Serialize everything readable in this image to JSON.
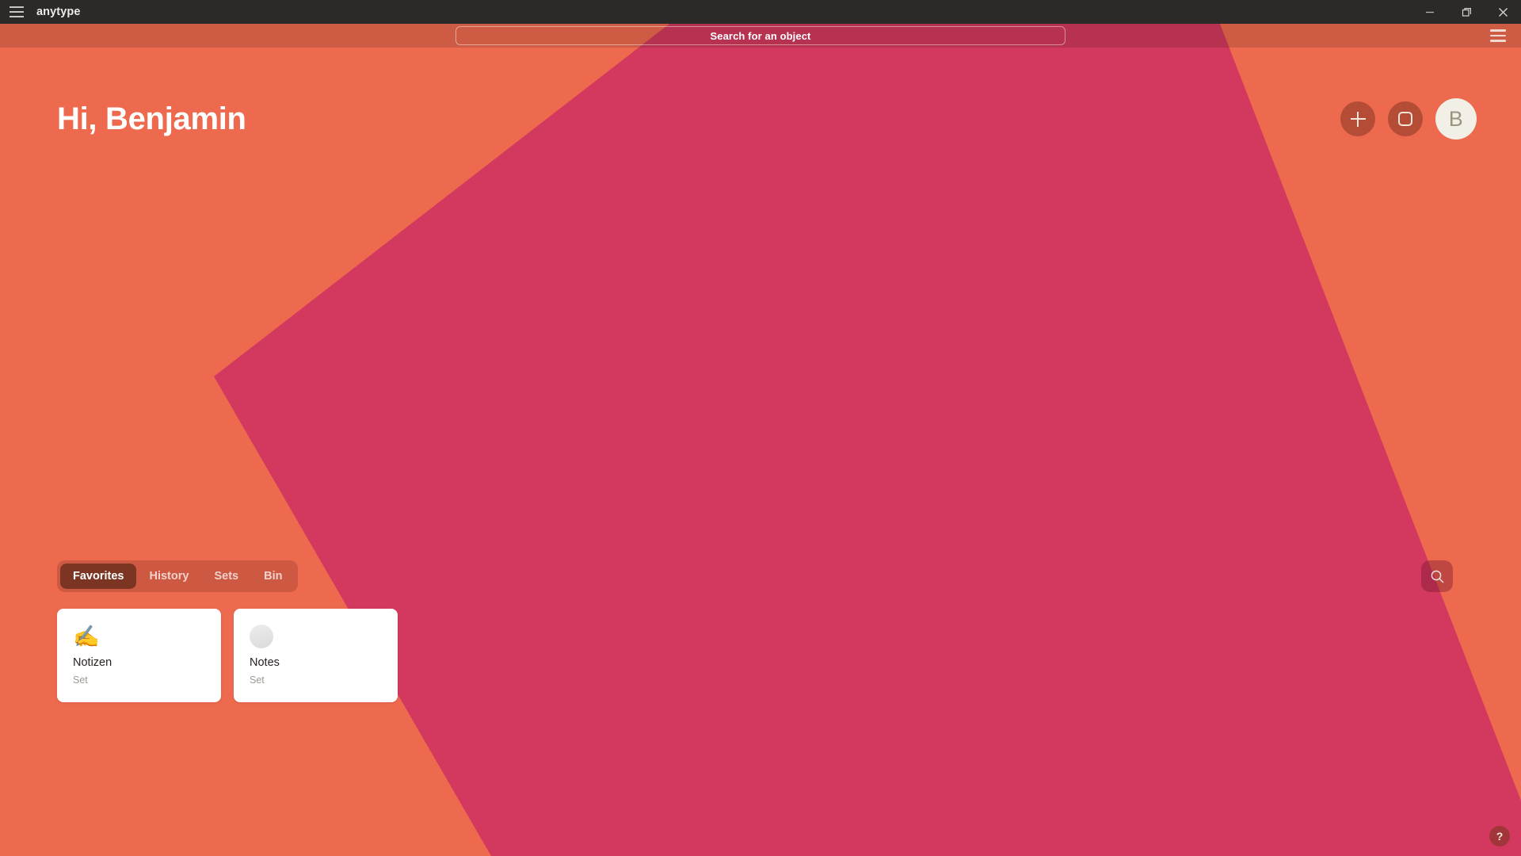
{
  "window": {
    "app_name": "anytype",
    "menu_icon": "hamburger-icon",
    "minimize_label": "minimize-icon",
    "maximize_label": "restore-icon",
    "close_label": "close-icon"
  },
  "topbar": {
    "search_placeholder": "Search for an object",
    "search_text": "Search for an object",
    "menu_icon": "hamburger-icon"
  },
  "hero": {
    "greeting": "Hi, Benjamin",
    "create_label": "plus-icon",
    "spaces_label": "rounded-square-icon",
    "avatar_initial": "B"
  },
  "tabs": [
    {
      "label": "Favorites",
      "active": true
    },
    {
      "label": "History",
      "active": false
    },
    {
      "label": "Sets",
      "active": false
    },
    {
      "label": "Bin",
      "active": false
    }
  ],
  "search_fab": {
    "icon": "search-icon"
  },
  "cards": [
    {
      "icon": "✍️",
      "icon_type": "emoji",
      "title": "Notizen",
      "subtitle": "Set"
    },
    {
      "icon": "",
      "icon_type": "blank-circle",
      "title": "Notes",
      "subtitle": "Set"
    }
  ],
  "help": {
    "label": "?"
  },
  "colors": {
    "background_orange": "#ED6A4F",
    "background_magenta": "#D3395E",
    "titlebar": "#2B2A28",
    "tab_active_bg": "#7B3522",
    "avatar_bg": "#F2EFE6",
    "card_bg": "#FFFFFF"
  }
}
